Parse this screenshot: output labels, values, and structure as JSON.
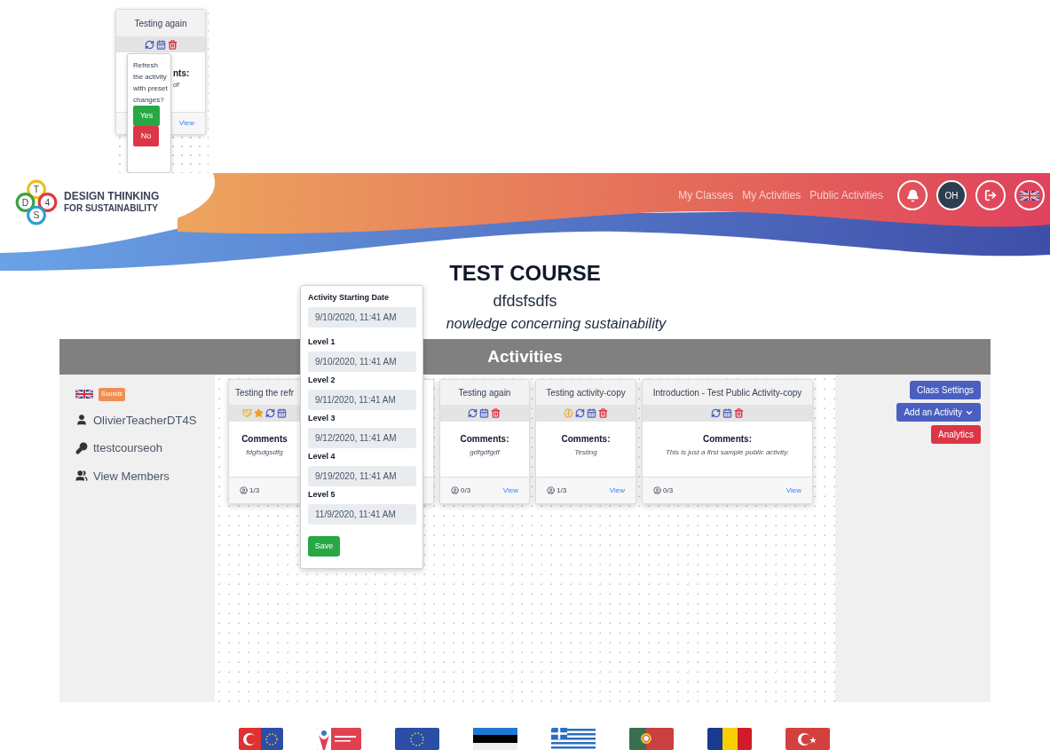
{
  "confirm_snippet": {
    "card": {
      "title": "Testing again",
      "shared": false,
      "starred": false,
      "thinking": false,
      "deletable": true,
      "comments_heading": "nts:",
      "comment": "df",
      "link": "View"
    },
    "popover": {
      "text": "Refresh the activity with preset changes?",
      "confirm": "Yes",
      "cancel": "No"
    }
  },
  "header": {
    "logo": {
      "letters": [
        "T",
        "D",
        "4",
        "S"
      ],
      "title": "DESIGN THINKING",
      "subtitle": "FOR SUSTAINABILITY"
    },
    "nav": [
      "My Classes",
      "My Activities",
      "Public Activities"
    ],
    "avatar": "OH"
  },
  "course": {
    "title": "TEST COURSE",
    "code": "dfdsfsdfs",
    "description": "nowledge concerning sustainability"
  },
  "section_title": "Activities",
  "sidebar": {
    "badge": "Sounds",
    "items": [
      {
        "kind": "teacher",
        "label": "OlivierTeacherDT4S"
      },
      {
        "kind": "key",
        "label": "ttestcourseoh"
      },
      {
        "kind": "members",
        "label": "View Members"
      }
    ]
  },
  "activities": [
    {
      "title": "Testing the refr",
      "shared": true,
      "starred": true,
      "thinking": false,
      "deletable": false,
      "comments_heading": "Comments",
      "comment": "fdgfsdgsdfg",
      "participants": "1/3"
    },
    {
      "title": "Testing again",
      "shared": false,
      "starred": false,
      "thinking": false,
      "deletable": true,
      "comments_heading": "Comments:",
      "comment": "gdfgdfgdf",
      "participants": "0/3",
      "link": "View"
    },
    {
      "title": "Testing activity-copy",
      "shared": false,
      "starred": false,
      "thinking": true,
      "deletable": true,
      "comments_heading": "Comments:",
      "comment": "Testing",
      "participants": "1/3",
      "link": "View"
    },
    {
      "title": "Introduction - Test Public Activity-copy",
      "shared": false,
      "starred": false,
      "thinking": false,
      "deletable": true,
      "comments_heading": "Comments:",
      "comment": "This is just a first sample public activity.",
      "participants": "0/3",
      "link": "View"
    }
  ],
  "date_popover": {
    "fields": [
      {
        "label": "Activity Starting Date",
        "value": "9/10/2020, 11:41 AM"
      },
      {
        "label": "Level 1",
        "value": "9/10/2020, 11:41 AM"
      },
      {
        "label": "Level 2",
        "value": "9/11/2020, 11:41 AM"
      },
      {
        "label": "Level 3",
        "value": "9/12/2020, 11:41 AM"
      },
      {
        "label": "Level 4",
        "value": "9/19/2020, 11:41 AM"
      },
      {
        "label": "Level 5",
        "value": "11/9/2020, 11:41 AM"
      }
    ],
    "save": "Save"
  },
  "actions": [
    {
      "kind": "primary",
      "label": "Class Settings",
      "dropdown": false
    },
    {
      "kind": "primary",
      "label": "Add an Activity",
      "dropdown": true
    },
    {
      "kind": "danger",
      "label": "Analytics",
      "dropdown": false
    }
  ]
}
